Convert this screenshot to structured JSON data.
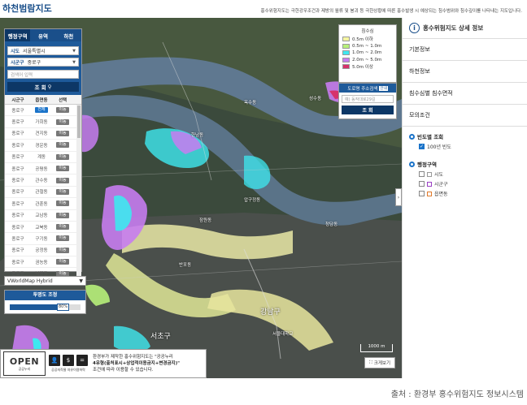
{
  "header": {
    "title": "하천범람지도",
    "description": "홍수위험지도는 극한강우조건과 제방의 월류 및 붕괴 등 극한상황에 따른 홍수발생 시 예상되는 침수범위와 침수깊이를 나타내는 지도입니다."
  },
  "search_panel": {
    "tabs": [
      {
        "label": "행정구역",
        "active": true
      },
      {
        "label": "유역",
        "active": false
      },
      {
        "label": "하천",
        "active": false
      }
    ],
    "sido_label": "시도",
    "sido_value": "서울특별시",
    "sigungu_label": "시군구",
    "sigungu_value": "중로구",
    "search_placeholder": "검색어 입력",
    "search_button": "조 회",
    "table_headers": [
      "시군구",
      "읍면동",
      "선택"
    ],
    "rows": [
      {
        "sigungu": "종로구",
        "dong": "전체",
        "select": "이동",
        "highlight": true
      },
      {
        "sigungu": "종로구",
        "dong": "가회동",
        "select": "이동"
      },
      {
        "sigungu": "종로구",
        "dong": "견지동",
        "select": "이동"
      },
      {
        "sigungu": "종로구",
        "dong": "경운동",
        "select": "이동"
      },
      {
        "sigungu": "종로구",
        "dong": "계동",
        "select": "이동"
      },
      {
        "sigungu": "종로구",
        "dong": "공평동",
        "select": "이동"
      },
      {
        "sigungu": "종로구",
        "dong": "관수동",
        "select": "이동"
      },
      {
        "sigungu": "종로구",
        "dong": "관철동",
        "select": "이동"
      },
      {
        "sigungu": "종로구",
        "dong": "관훈동",
        "select": "이동"
      },
      {
        "sigungu": "종로구",
        "dong": "교남동",
        "select": "이동"
      },
      {
        "sigungu": "종로구",
        "dong": "교북동",
        "select": "이동"
      },
      {
        "sigungu": "종로구",
        "dong": "구기동",
        "select": "이동"
      },
      {
        "sigungu": "종로구",
        "dong": "궁정동",
        "select": "이동"
      },
      {
        "sigungu": "종로구",
        "dong": "권농동",
        "select": "이동"
      },
      {
        "sigungu": "종로구",
        "dong": "낙원동",
        "select": "이동"
      }
    ]
  },
  "basemap": {
    "value": "VWorldMap Hybrid"
  },
  "transparency": {
    "title": "투명도 조정",
    "value": 80,
    "value_label": "80%"
  },
  "legend": {
    "title": "침수심",
    "items": [
      {
        "label": "0.5m 이하",
        "color": "#f5f5a0"
      },
      {
        "label": "0.5m ~ 1.0m",
        "color": "#b7f07a"
      },
      {
        "label": "1.0m ~ 2.0m",
        "color": "#3ee8f0"
      },
      {
        "label": "2.0m ~ 5.0m",
        "color": "#c77cf0"
      },
      {
        "label": "5.0m 이상",
        "color": "#d6336c"
      }
    ]
  },
  "address_search": {
    "title": "도로명 주소검색",
    "badge": "안내",
    "placeholder": "예) 동작대로29길",
    "button": "조 회"
  },
  "copyright": {
    "open_title": "OPEN",
    "open_sub": "공공누리",
    "license_text": "공공저작물 자유이용허락",
    "line1": "환경부가 제작한 홍수위험지도는 \"공공누리",
    "line2": "4유형(출처표시+상업적이용금지+변경금지)\"",
    "line3": "조건에 따라 이용할 수 있습니다."
  },
  "map": {
    "scale_label": "1000 m",
    "bigview_label": "크게보기",
    "labels": [
      "압구정동",
      "서울대학교",
      "성수동",
      "청담동",
      "강남구",
      "서초구",
      "잠원동",
      "반포동",
      "한남동",
      "옥수동"
    ]
  },
  "sidebar": {
    "title": "홍수위험지도 상세 정보",
    "sections": [
      "기본정보",
      "하천정보",
      "침수심별 침수면적",
      "모의조건"
    ],
    "frequency": {
      "title": "빈도별 조회",
      "option": "100년 빈도",
      "checked": true
    },
    "admin": {
      "title": "행정구역",
      "options": [
        {
          "label": "시도",
          "color": "#ffffff"
        },
        {
          "label": "시군구",
          "color": "#9b3fc4"
        },
        {
          "label": "읍면동",
          "color": "#e07a2b"
        }
      ]
    }
  },
  "source_caption": "출처 : 환경부 홍수위험지도 정보시스템"
}
